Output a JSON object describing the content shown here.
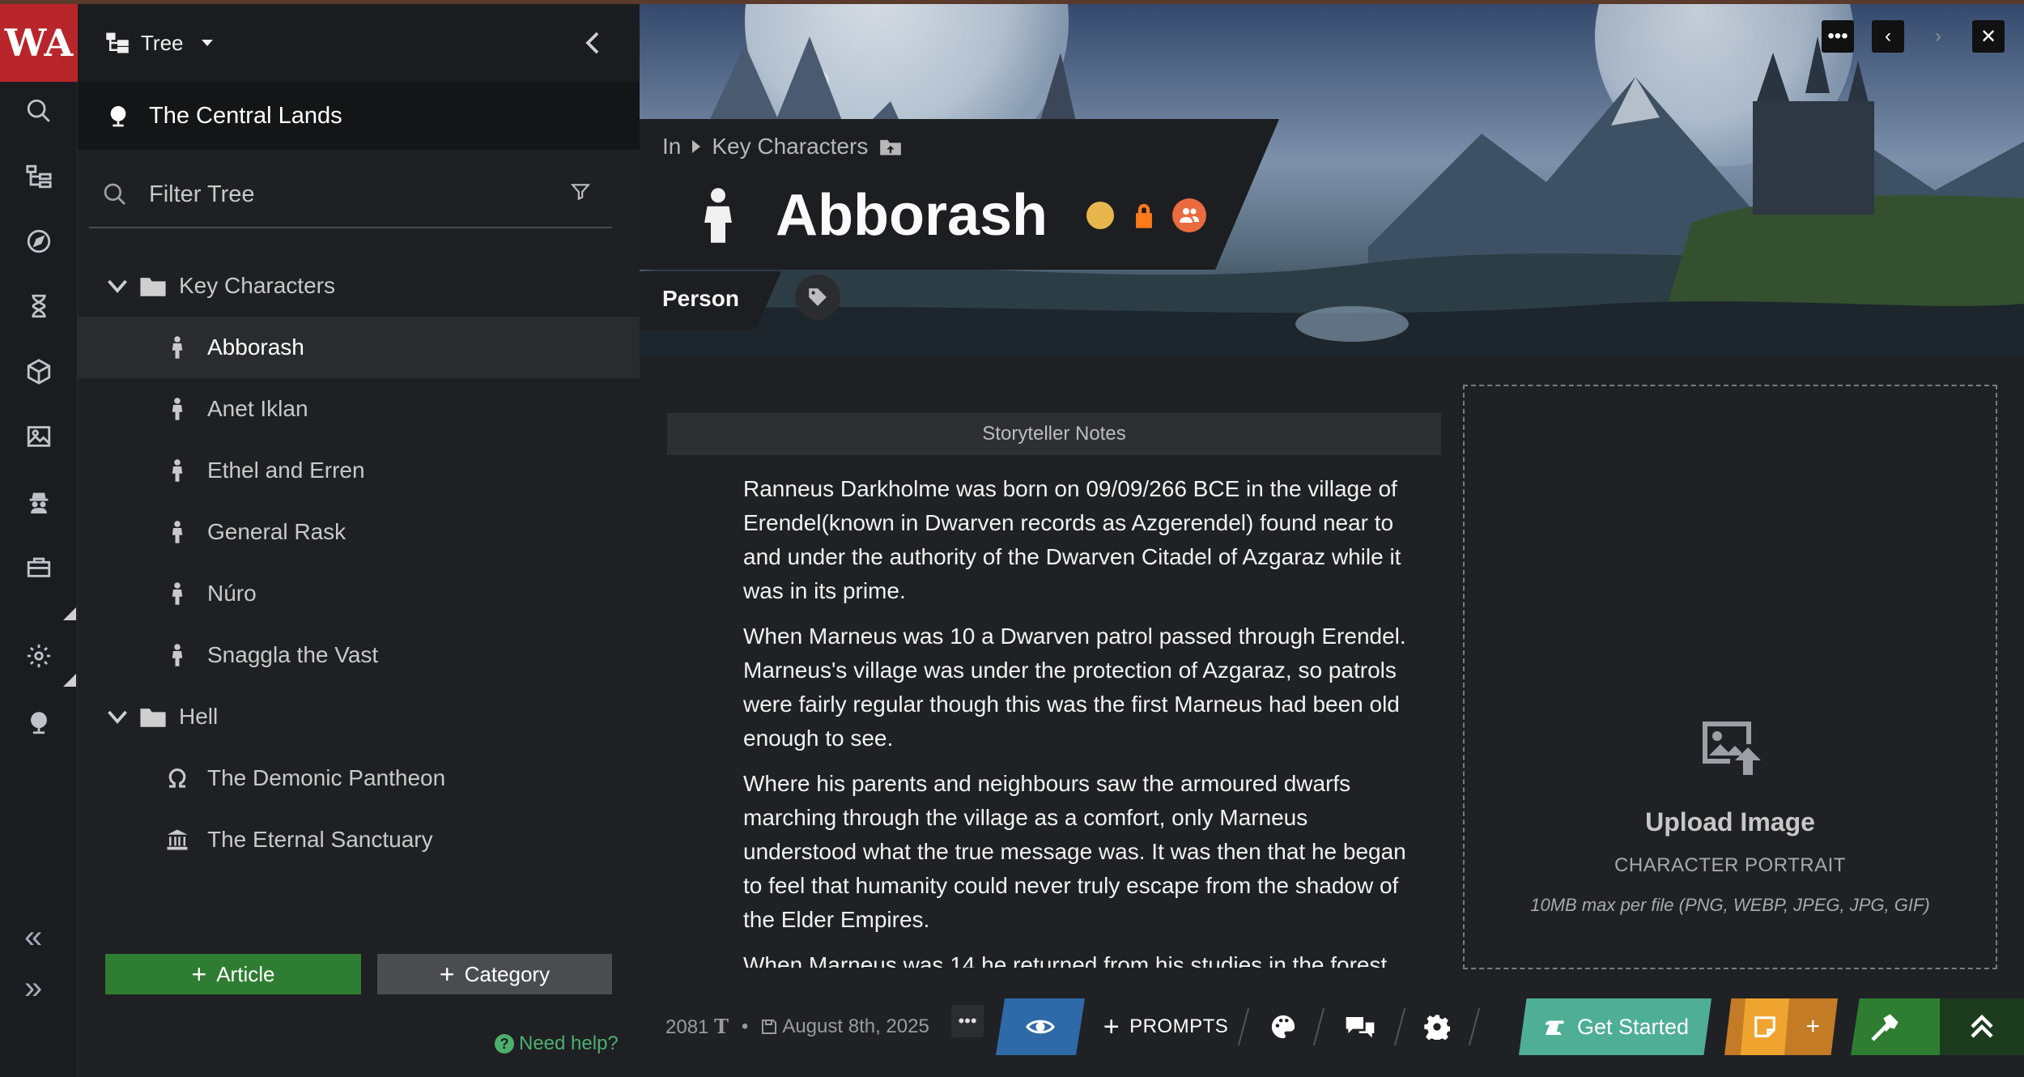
{
  "sidebar": {
    "mode_label": "Tree",
    "world_name": "The Central Lands",
    "filter_placeholder": "Filter Tree",
    "categories": [
      {
        "label": "Key Characters",
        "items": [
          "Abborash",
          "Anet Iklan",
          "Ethel and Erren",
          "General Rask",
          "Núro",
          "Snaggla the Vast"
        ]
      },
      {
        "label": "Hell",
        "items": [
          "The Demonic Pantheon",
          "The Eternal Sanctuary"
        ]
      }
    ],
    "selected_item": "Abborash",
    "add_article_label": "Article",
    "add_category_label": "Category",
    "help_label": "Need help?"
  },
  "header": {
    "breadcrumb_in": "In",
    "breadcrumb_parent": "Key Characters",
    "title": "Abborash",
    "type_label": "Person"
  },
  "content": {
    "notes_heading": "Storyteller Notes",
    "paragraphs": [
      "Ranneus Darkholme was born on 09/09/266 BCE in the village of Erendel(known in Dwarven records as Azgerendel) found near to and under the authority of the Dwarven Citadel of Azgaraz while it was in its prime.",
      "When Marneus was 10 a Dwarven patrol passed through Erendel. Marneus's village was under the protection of Azgaraz, so patrols were fairly regular though this was the first Marneus had been old enough to see.",
      "Where his parents and neighbours saw the armoured dwarfs marching through the village as a comfort, only Marneus understood what the true message was. It was then that he began to feel that humanity could never truly escape from the shadow of the Elder Empires.",
      "When Marneus was 14 he returned from his studies in the forest"
    ]
  },
  "upload": {
    "title": "Upload Image",
    "subtitle": "CHARACTER PORTRAIT",
    "note": "10MB max per file (PNG, WEBP, JPEG, JPG, GIF)"
  },
  "footer": {
    "word_count": "2081",
    "separator": "•",
    "date": "August 8th, 2025",
    "prompts_label": "PROMPTS",
    "get_started_label": "Get Started"
  },
  "colors": {
    "brand_red": "#b8262b",
    "article_green": "#2f7d32",
    "view_blue": "#2f6aa8",
    "get_started_teal": "#4fae96",
    "notes_orange": "#f0a430",
    "status_yellow": "#e8b64c",
    "lock_orange": "#ff7a1a"
  },
  "icons": {
    "rail": [
      "search-icon",
      "tree-icon",
      "compass-icon",
      "hourglass-icon",
      "cube-icon",
      "image-icon",
      "spy-icon",
      "toolbox-icon",
      "gear-icon",
      "globe-icon"
    ]
  }
}
